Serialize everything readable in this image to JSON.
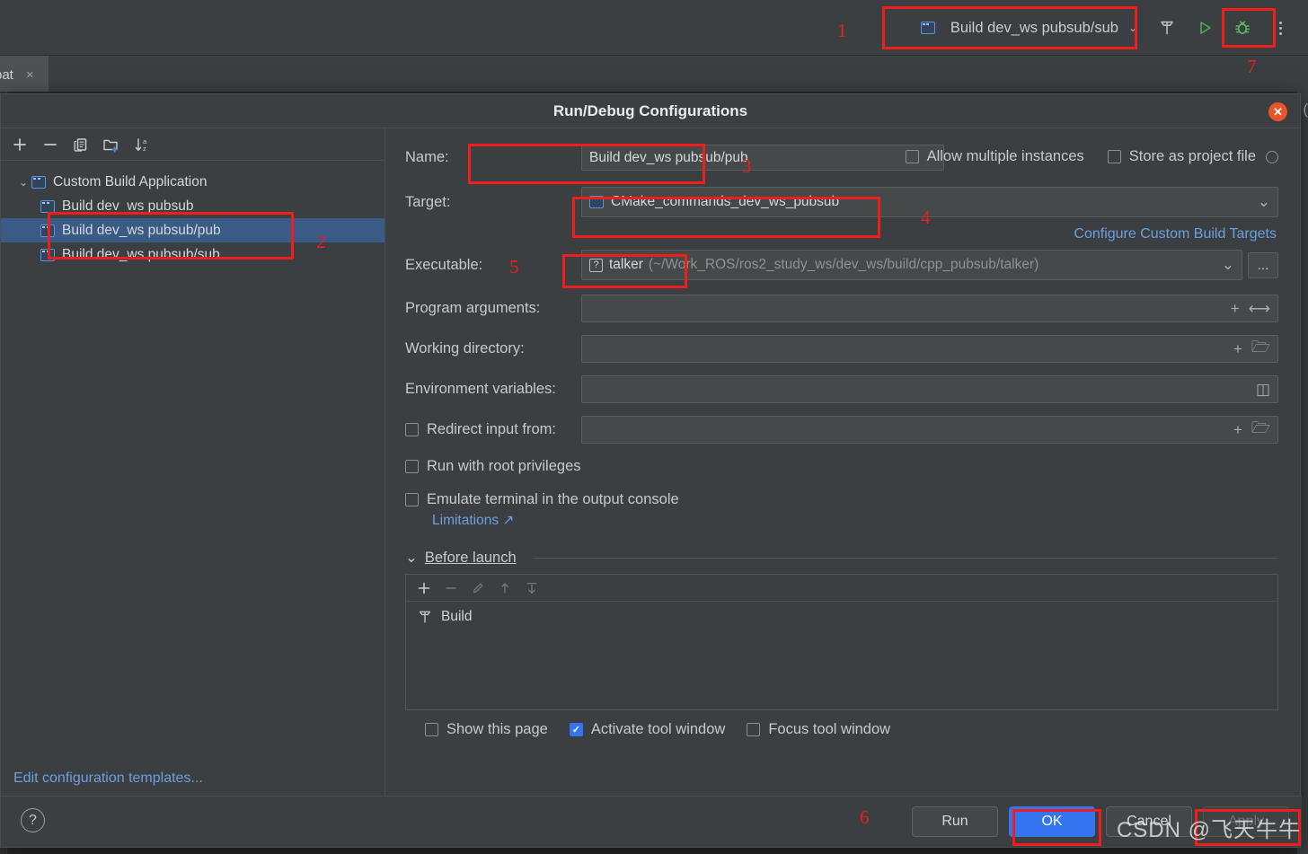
{
  "ide": {
    "run_config_widget": {
      "label": "Build dev_ws pubsub/sub",
      "icon": "run-configuration-icon",
      "chevron": "⌄"
    },
    "toolbar_icons": [
      {
        "name": "build-hammer-icon",
        "title": "Build"
      },
      {
        "name": "run-play-icon",
        "title": "Run"
      },
      {
        "name": "debug-bug-icon",
        "title": "Debug"
      },
      {
        "name": "more-options-kebab-icon",
        "title": "More"
      }
    ],
    "editor_tab": {
      "label": "bat",
      "close": "×"
    },
    "right_edge_char": "("
  },
  "dialog": {
    "title": "Run/Debug Configurations",
    "close_label": "✕",
    "tree_toolbar": [
      {
        "name": "add-configuration-button",
        "glyph": "+"
      },
      {
        "name": "remove-configuration-button",
        "glyph": "−"
      },
      {
        "name": "copy-configuration-button",
        "glyph": "copy-icon"
      },
      {
        "name": "new-folder-button",
        "glyph": "folder-add-icon"
      },
      {
        "name": "sort-configurations-button",
        "glyph": "sort-az-icon"
      }
    ],
    "tree": {
      "root": {
        "label": "Custom Build Application",
        "expanded": true,
        "arrow": "⌄"
      },
      "children": [
        {
          "label": "Build dev_ws pubsub",
          "selected": false
        },
        {
          "label": "Build dev_ws pubsub/pub",
          "selected": true
        },
        {
          "label": "Build dev_ws pubsub/sub",
          "selected": false
        }
      ]
    },
    "edit_templates_link": "Edit configuration templates...",
    "form": {
      "name_label": "Name:",
      "name_value": "Build dev_ws pubsub/pub",
      "allow_multiple_instances": {
        "label": "Allow multiple instances",
        "checked": false
      },
      "store_as_project_file": {
        "label": "Store as project file",
        "checked": false
      },
      "target_label": "Target:",
      "target_value": "CMake_commands_dev_ws_pubsub",
      "configure_targets_link": "Configure Custom Build Targets",
      "executable_label": "Executable:",
      "executable_name": "talker",
      "executable_path": "(~/Work_ROS/ros2_study_ws/dev_ws/build/cpp_pubsub/talker)",
      "executable_browse": "...",
      "program_arguments_label": "Program arguments:",
      "program_arguments_value": "",
      "working_directory_label": "Working directory:",
      "working_directory_value": "",
      "environment_variables_label": "Environment variables:",
      "environment_variables_value": "",
      "redirect_input_from": {
        "label": "Redirect input from:",
        "checked": false,
        "value": ""
      },
      "run_with_root_privileges": {
        "label": "Run with root privileges",
        "checked": false
      },
      "emulate_terminal": {
        "label": "Emulate terminal in the output console",
        "checked": false
      },
      "limitations_link": "Limitations ↗"
    },
    "before_launch": {
      "title": "Before launch",
      "arrow": "⌄",
      "toolbar": [
        {
          "name": "add-task-button",
          "glyph": "+"
        },
        {
          "name": "remove-task-button",
          "glyph": "−"
        },
        {
          "name": "edit-task-button",
          "glyph": "pencil-icon"
        },
        {
          "name": "move-task-up-button",
          "glyph": "arrow-up-icon"
        },
        {
          "name": "move-task-down-button",
          "glyph": "arrow-down-icon"
        }
      ],
      "tasks": [
        {
          "label": "Build",
          "icon": "hammer-icon"
        }
      ],
      "options": [
        {
          "label": "Show this page",
          "checked": false
        },
        {
          "label": "Activate tool window",
          "checked": true
        },
        {
          "label": "Focus tool window",
          "checked": false
        }
      ]
    },
    "footer": {
      "help": "?",
      "buttons": [
        {
          "label": "Run",
          "style": "default",
          "disabled": false
        },
        {
          "label": "OK",
          "style": "primary",
          "disabled": false
        },
        {
          "label": "Cancel",
          "style": "default",
          "disabled": false
        },
        {
          "label": "Apply",
          "style": "default",
          "disabled": true
        }
      ]
    }
  },
  "annotations": {
    "numbers": [
      "1",
      "2",
      "3",
      "4",
      "5",
      "6",
      "7"
    ]
  },
  "watermark": "CSDN @飞天牛牛",
  "colors": {
    "accent_blue": "#3574f0",
    "link_blue": "#6c9fe0",
    "selection_blue": "#3b5b87",
    "annotation_red": "#f01d1d",
    "dialog_bg": "#3c3f41",
    "editor_bg": "#2b2b2b",
    "field_bg": "#45494a",
    "close_orange": "#e8552a",
    "debug_green": "#5bb85b"
  }
}
